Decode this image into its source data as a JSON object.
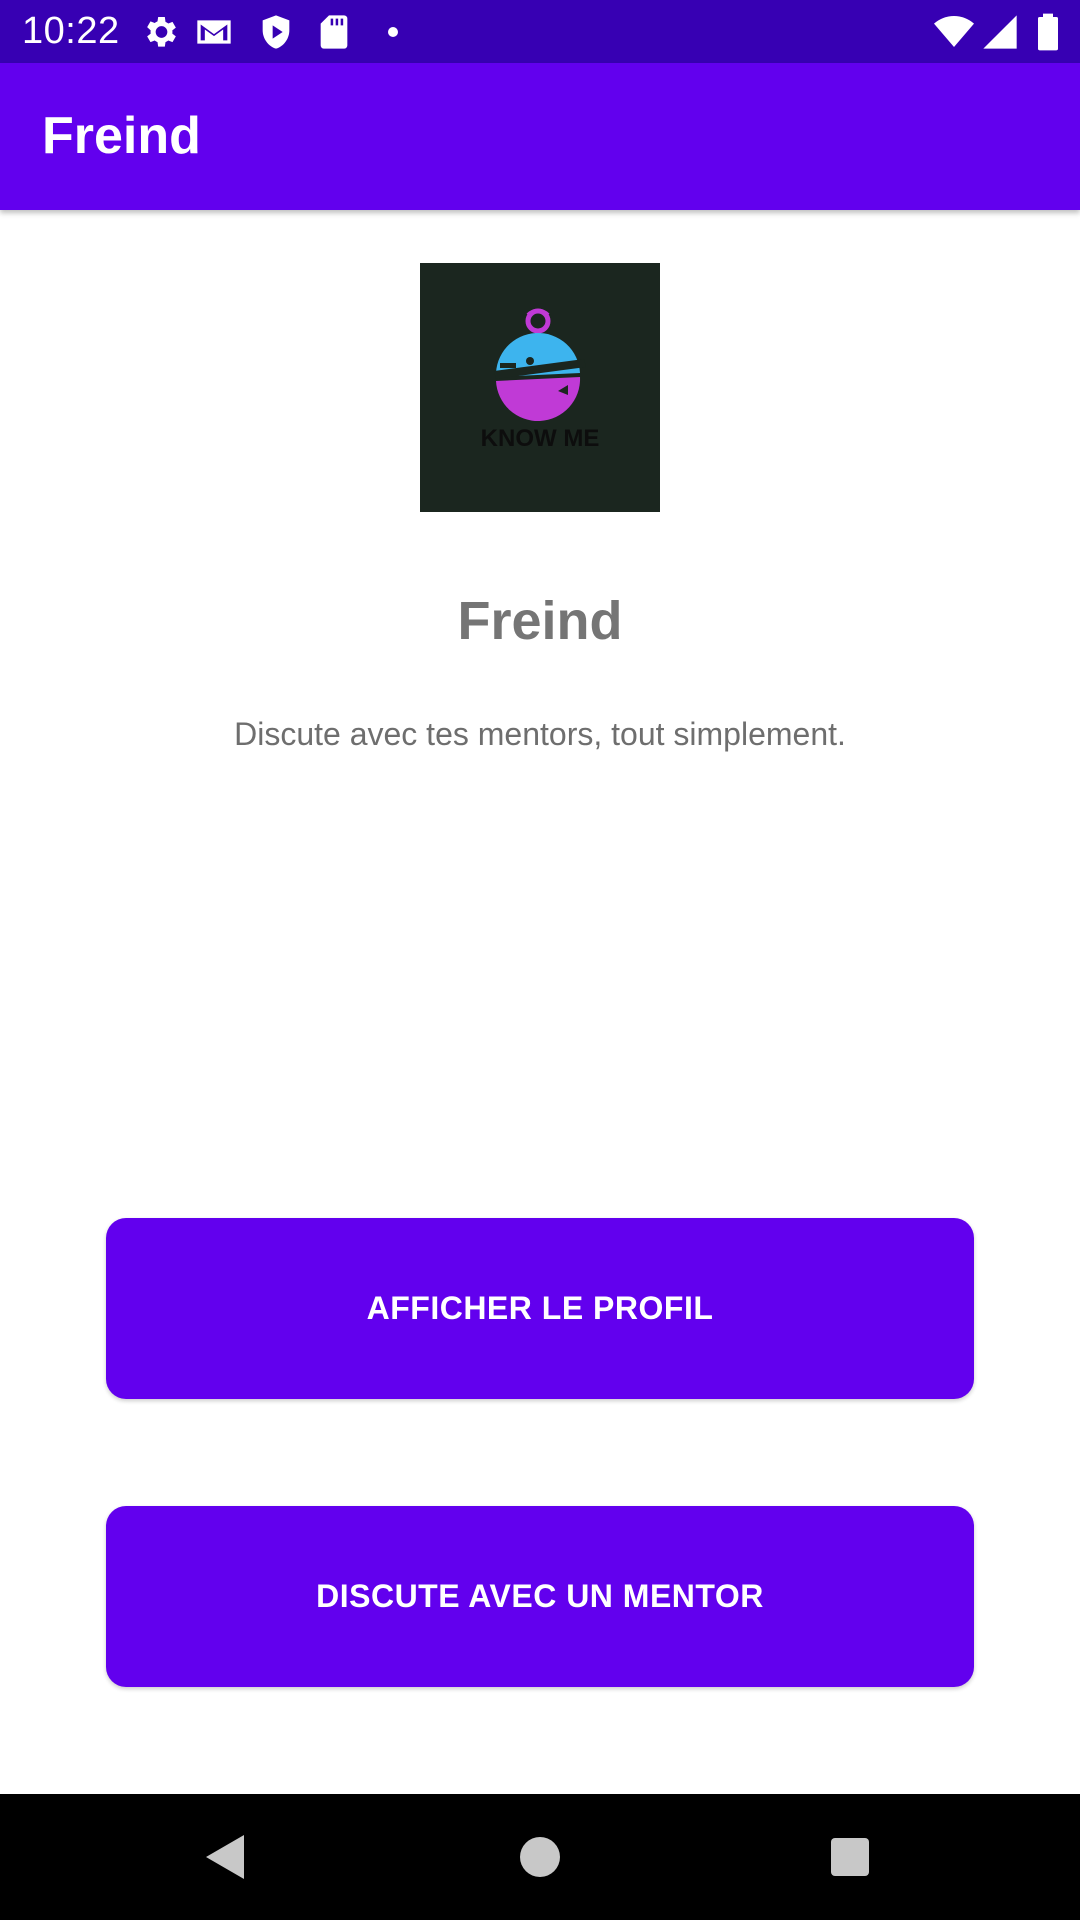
{
  "status_bar": {
    "time": "10:22",
    "left_icons": [
      "gear-icon",
      "gmail-icon",
      "shield-play-icon",
      "sd-card-icon",
      "dot-icon"
    ],
    "right_icons": [
      "wifi-icon",
      "signal-icon",
      "battery-icon"
    ]
  },
  "app_bar": {
    "title": "Freind"
  },
  "logo": {
    "icon": "know-me-logo-icon",
    "text": "KNOW ME"
  },
  "main": {
    "headline": "Freind",
    "subtitle": "Discute avec tes mentors, tout simplement."
  },
  "buttons": {
    "profile_label": "AFFICHER LE PROFIL",
    "mentor_label": "DISCUTE AVEC UN MENTOR"
  },
  "nav_bar": {
    "icons": [
      "back-icon",
      "home-icon",
      "recents-icon"
    ]
  },
  "colors": {
    "status_bar": "#3700b3",
    "primary": "#6200ee",
    "logo_background": "#1b261f",
    "headline_text": "#757575"
  }
}
